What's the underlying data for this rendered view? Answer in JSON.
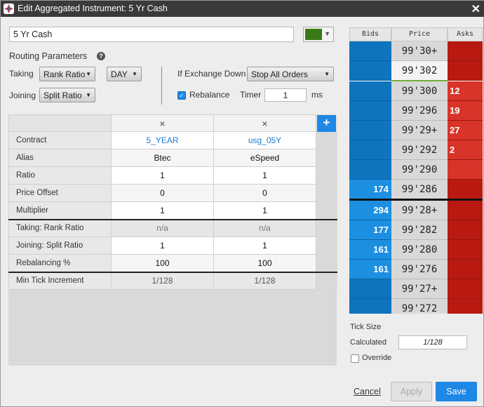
{
  "window": {
    "title": "Edit Aggregated Instrument: 5 Yr Cash",
    "close_icon": "close-icon"
  },
  "instrument": {
    "name": "5 Yr Cash",
    "color": "#3a7a16"
  },
  "routing": {
    "title": "Routing Parameters",
    "taking_label": "Taking",
    "taking_value": "Rank Ratio",
    "tif_value": "DAY",
    "joining_label": "Joining",
    "joining_value": "Split Ratio",
    "exchange_down_label": "If Exchange Down",
    "exchange_down_value": "Stop All Orders",
    "rebalance_label": "Rebalance",
    "rebalance_checked": true,
    "timer_label": "Timer",
    "timer_value": "1",
    "timer_unit": "ms"
  },
  "grid": {
    "remove_icon": "×",
    "add_icon": "+",
    "rows": [
      {
        "label": "Contract",
        "values": [
          "5_YEAR",
          "usg_05Y"
        ]
      },
      {
        "label": "Alias",
        "values": [
          "Btec",
          "eSpeed"
        ]
      },
      {
        "label": "Ratio",
        "values": [
          "1",
          "1"
        ]
      },
      {
        "label": "Price Offset",
        "values": [
          "0",
          "0"
        ]
      },
      {
        "label": "Multiplier",
        "values": [
          "1",
          "1"
        ]
      },
      {
        "label": "Taking: Rank Ratio",
        "values": [
          "n/a",
          "n/a"
        ]
      },
      {
        "label": "Joining: Split Ratio",
        "values": [
          "1",
          "1"
        ]
      },
      {
        "label": "Rebalancing %",
        "values": [
          "100",
          "100"
        ]
      },
      {
        "label": "Min Tick Increment",
        "values": [
          "1/128",
          "1/128"
        ]
      }
    ]
  },
  "ladder": {
    "headers": [
      "Bids",
      "Price",
      "Asks"
    ],
    "rows": [
      {
        "bid": "",
        "price": "99'30+",
        "ask": ""
      },
      {
        "bid": "",
        "price": "99'302",
        "ask": ""
      },
      {
        "bid": "",
        "price": "99'300",
        "ask": "12"
      },
      {
        "bid": "",
        "price": "99'296",
        "ask": "19"
      },
      {
        "bid": "",
        "price": "99'29+",
        "ask": "27"
      },
      {
        "bid": "",
        "price": "99'292",
        "ask": "2"
      },
      {
        "bid": "",
        "price": "99'290",
        "ask": ""
      },
      {
        "bid": "174",
        "price": "99'286",
        "ask": ""
      },
      {
        "bid": "294",
        "price": "99'28+",
        "ask": ""
      },
      {
        "bid": "177",
        "price": "99'282",
        "ask": ""
      },
      {
        "bid": "161",
        "price": "99'280",
        "ask": ""
      },
      {
        "bid": "161",
        "price": "99'276",
        "ask": ""
      },
      {
        "bid": "",
        "price": "99'27+",
        "ask": ""
      },
      {
        "bid": "",
        "price": "99'272",
        "ask": ""
      }
    ]
  },
  "tick": {
    "title": "Tick Size",
    "calculated_label": "Calculated",
    "calculated_value": "1/128",
    "override_label": "Override",
    "override_checked": false
  },
  "buttons": {
    "cancel": "Cancel",
    "apply": "Apply",
    "save": "Save"
  }
}
